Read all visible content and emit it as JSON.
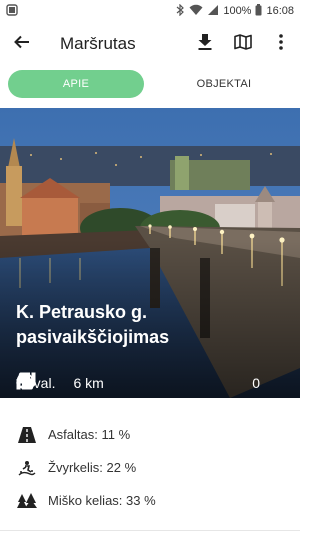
{
  "status_bar": {
    "battery": "100%",
    "time": "16:08",
    "icons": [
      "screenshot-icon",
      "bluetooth-icon",
      "wifi-icon",
      "signal-icon",
      "battery-icon"
    ]
  },
  "app_bar": {
    "title": "Maršrutas",
    "icons": [
      "back-arrow-icon",
      "download-icon",
      "map-icon",
      "more-vert-icon"
    ]
  },
  "tabs": [
    {
      "label": "APIE",
      "active": true
    },
    {
      "label": "OBJEKTAI",
      "active": false
    }
  ],
  "hero": {
    "title": "K. Petrausko g. pasivaikščiojimas",
    "duration": "9 val.",
    "distance": "6 km",
    "likes": "0",
    "icons": [
      "clock-icon",
      "bicycle-icon",
      "thumbs-up-icon",
      "thumbs-down-icon"
    ]
  },
  "surfaces": [
    {
      "label": "Asfaltas: 11 %",
      "icon": "road-icon"
    },
    {
      "label": "Žvyrkelis: 22 %",
      "icon": "gravel-icon"
    },
    {
      "label": "Miško kelias: 33 %",
      "icon": "forest-icon"
    }
  ],
  "colors": {
    "accent": "#72cf8e",
    "text": "#222222"
  }
}
